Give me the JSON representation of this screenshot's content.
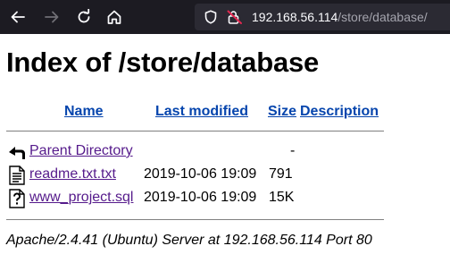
{
  "browser": {
    "url_host": "192.168.56.114",
    "url_path": "/store/database/"
  },
  "page": {
    "title": "Index of /store/database",
    "columns": {
      "name": "Name",
      "last_modified": "Last modified",
      "size": "Size",
      "description": "Description"
    },
    "rows": [
      {
        "icon": "back-arrow-icon",
        "name": "Parent Directory",
        "modified": "",
        "size": "-"
      },
      {
        "icon": "text-file-icon",
        "name": "readme.txt.txt",
        "modified": "2019-10-06 19:09",
        "size": "791"
      },
      {
        "icon": "unknown-file-icon",
        "name": "www_project.sql",
        "modified": "2019-10-06 19:09",
        "size": "15K"
      }
    ],
    "footer": "Apache/2.4.41 (Ubuntu) Server at 192.168.56.114 Port 80"
  }
}
